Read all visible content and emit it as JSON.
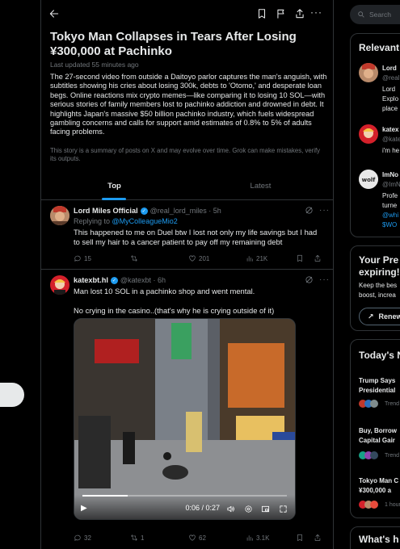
{
  "post": {
    "headline": "Tokyo Man Collapses in Tears After Losing ¥300,000 at Pachinko",
    "updated": "Last updated 55 minutes ago",
    "summary": "The 27-second video from outside a Daitoyo parlor captures the man's anguish, with subtitles showing his cries about losing 300k, debts to 'Otomo,' and desperate loan begs. Online reactions mix crypto memes—like comparing it to losing 10 SOL—with serious stories of family members lost to pachinko addiction and drowned in debt. It highlights Japan's massive $50 billion pachinko industry, which fuels widespread gambling concerns and calls for support amid estimates of 0.8% to 5% of adults facing problems.",
    "disclaimer": "This story is a summary of posts on X and may evolve over time. Grok can make mistakes, verify its outputs."
  },
  "tabs": [
    "Top",
    "Latest"
  ],
  "tweets": [
    {
      "name": "Lord Miles Official",
      "handle": "@real_lord_miles · 5h",
      "reply_prefix": "Replying to",
      "reply_to": "@MyColleagueMio2",
      "text": "This happened to me on Duel btw I lost not only my life savings but I had to sell my hair to a cancer patient to pay off my remaining debt",
      "replies": "15",
      "retweets": "",
      "likes": "201",
      "views": "21K"
    },
    {
      "name": "katexbt.hl",
      "handle": "@katexbt · 6h",
      "text": "Man lost 10 SOL in a pachinko shop and went mental.\n\nNo crying in the casino..(that's why he is crying outside of it)",
      "video_time": "0:06 / 0:27",
      "video_progress": 0.22,
      "replies": "32",
      "retweets": "1",
      "likes": "62",
      "views": "3.1K"
    }
  ],
  "sidebar": {
    "search_placeholder": "Search",
    "relevant_title": "Relevant",
    "relevant": [
      {
        "name": "Lord",
        "handle": "@real",
        "bio": [
          "Lord",
          "Explo",
          "place"
        ]
      },
      {
        "name": "katex",
        "handle": "@kate",
        "bio": [
          "i'm he"
        ]
      },
      {
        "name": "ImNo",
        "handle": "@ImN",
        "bio": [
          "Profe",
          "turne",
          "@whi",
          "$WO"
        ]
      }
    ],
    "premium_title": [
      "Your Pre",
      "expiring!"
    ],
    "premium_text": [
      "Keep the bes",
      "boost, increa"
    ],
    "renew_label": "Renew",
    "today_title": "Today's N",
    "news": [
      {
        "title": [
          "Trump Says",
          "Presidential"
        ],
        "meta": "Trend"
      },
      {
        "title": [
          "Buy, Borrow",
          "Capital Gair"
        ],
        "meta": "Trend"
      },
      {
        "title": [
          "Tokyo Man C",
          "¥300,000 a"
        ],
        "meta": "1 hour"
      }
    ],
    "whats_title": "What's h"
  },
  "colors": {
    "accent": "#1d9bf0",
    "background": "#000000",
    "border": "#2f3336",
    "muted": "#71767b"
  }
}
